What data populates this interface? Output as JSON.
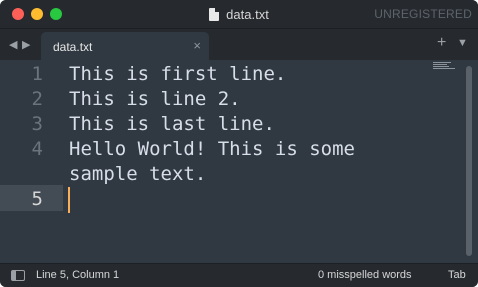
{
  "window": {
    "title": "data.txt",
    "license_status": "UNREGISTERED"
  },
  "tabs": [
    {
      "label": "data.txt",
      "close_icon": "×",
      "active": true
    }
  ],
  "tabbar": {
    "nav_left": "◀",
    "nav_right": "▶",
    "new_tab": "+",
    "menu": "▼"
  },
  "editor": {
    "line_numbers": [
      "1",
      "2",
      "3",
      "4",
      "",
      "5"
    ],
    "lines": [
      "This is first line.",
      "This is line 2.",
      "This is last line.",
      "Hello World! This is some",
      "sample text.",
      ""
    ],
    "current_line": "5"
  },
  "statusbar": {
    "position": "Line 5, Column 1",
    "spelling": "0 misspelled words",
    "indentation": "Tab"
  },
  "colors": {
    "editor_bg": "#303841",
    "chrome_bg": "#262a2f",
    "caret": "#f9ae58",
    "text": "#d8dee9"
  }
}
